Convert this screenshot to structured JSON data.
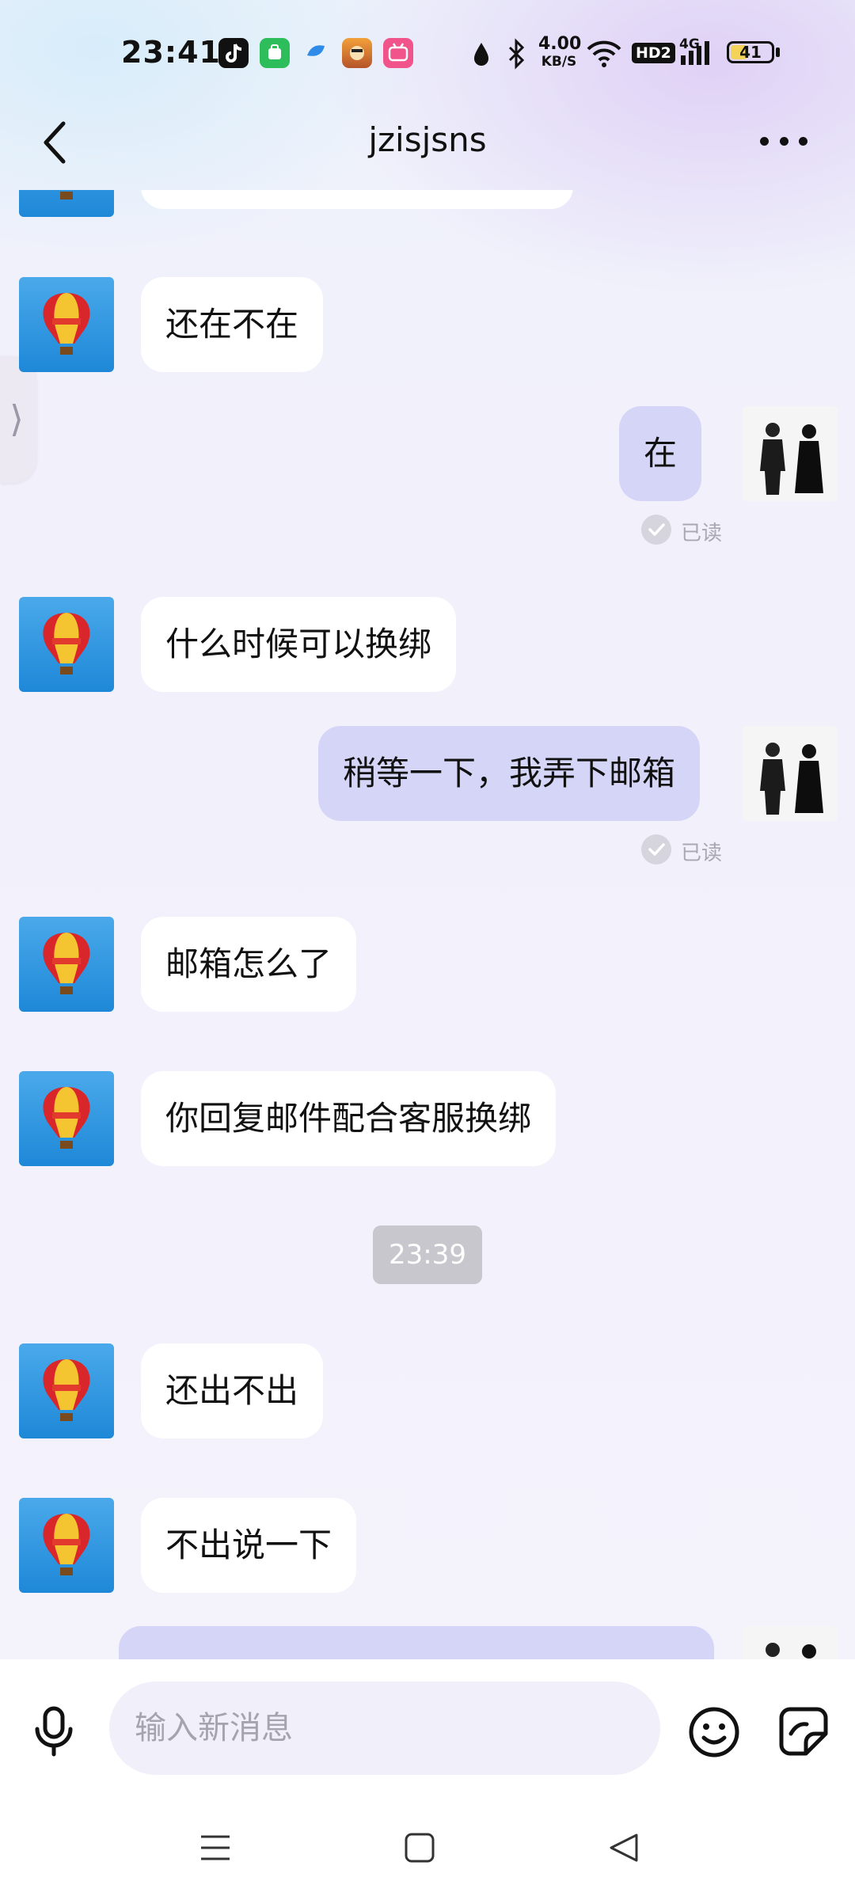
{
  "status_bar": {
    "time": "23:41",
    "net_speed_value": "4.00",
    "net_speed_unit": "KB/S",
    "hd_badge": "HD2",
    "network": "4G",
    "battery": "41",
    "battery_level": 0.41,
    "app_icons": [
      "tiktok-icon",
      "green-app-icon",
      "blue-app-icon",
      "game-app-icon",
      "bilibili-icon"
    ],
    "system_icons": [
      "drop-icon",
      "bluetooth-icon",
      "wifi-icon",
      "signal-icon",
      "battery-icon"
    ]
  },
  "header": {
    "title": "jzisjsns"
  },
  "messages": [
    {
      "side": "in",
      "text": "还在不在"
    },
    {
      "side": "out",
      "text": "在",
      "status": "已读"
    },
    {
      "side": "in",
      "text": "什么时候可以换绑"
    },
    {
      "side": "out",
      "text": "稍等一下，我弄下邮箱",
      "status": "已读"
    },
    {
      "side": "in",
      "text": "邮箱怎么了"
    },
    {
      "side": "in",
      "text": "你回复邮件配合客服换绑"
    },
    {
      "side": "in",
      "text": "还出不出"
    },
    {
      "side": "in",
      "text": "不出说一下"
    }
  ],
  "time_divider": "23:39",
  "input_bar": {
    "placeholder": "输入新消息"
  },
  "colors": {
    "outgoing_bubble": "#d5d6f7",
    "incoming_bubble": "#ffffff",
    "background": "#f3f1fb"
  }
}
